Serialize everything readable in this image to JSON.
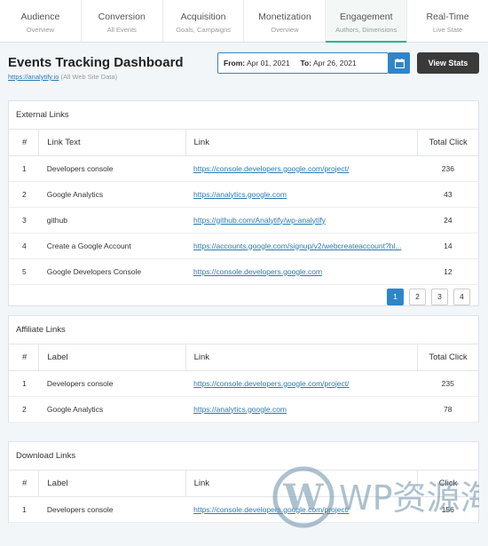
{
  "tabs": [
    {
      "title": "Audience",
      "sub": "Overview"
    },
    {
      "title": "Conversion",
      "sub": "All Events"
    },
    {
      "title": "Acquisition",
      "sub": "Goals, Campaigns"
    },
    {
      "title": "Monetization",
      "sub": "Overview"
    },
    {
      "title": "Engagement",
      "sub": "Authors, Dimensions"
    },
    {
      "title": "Real-Time",
      "sub": "Live State"
    }
  ],
  "header": {
    "title": "Events Tracking Dashboard",
    "site_url": "https://analytify.io",
    "site_note": "(All Web Site Data)"
  },
  "date": {
    "from_label": "From:",
    "from_value": "Apr 01, 2021",
    "to_label": "To:",
    "to_value": "Apr 26, 2021"
  },
  "view_stats": "View Stats",
  "external": {
    "title": "External Links",
    "cols": [
      "#",
      "Link Text",
      "Link",
      "Total Click"
    ],
    "rows": [
      {
        "n": "1",
        "text": "Developers console",
        "link": "https://console.developers.google.com/project/",
        "clicks": "236"
      },
      {
        "n": "2",
        "text": "Google Analytics",
        "link": "https://analytics.google.com",
        "clicks": "43"
      },
      {
        "n": "3",
        "text": "github",
        "link": "https://github.com/Analytify/wp-analytify",
        "clicks": "24"
      },
      {
        "n": "4",
        "text": "Create a Google Account",
        "link": "https://accounts.google.com/signup/v2/webcreateaccount?hl...",
        "clicks": "14"
      },
      {
        "n": "5",
        "text": "Google Developers Console",
        "link": "https://console.developers.google.com",
        "clicks": "12"
      }
    ],
    "pages": [
      "1",
      "2",
      "3",
      "4"
    ]
  },
  "affiliate": {
    "title": "Affiliate Links",
    "cols": [
      "#",
      "Label",
      "Link",
      "Total Click"
    ],
    "rows": [
      {
        "n": "1",
        "text": "Developers console",
        "link": "https://console.developers.google.com/project/",
        "clicks": "235"
      },
      {
        "n": "2",
        "text": "Google Analytics",
        "link": "https://analytics.google.com",
        "clicks": "78"
      }
    ]
  },
  "download": {
    "title": "Download Links",
    "cols": [
      "#",
      "Label",
      "Link",
      "Click"
    ],
    "rows": [
      {
        "n": "1",
        "text": "Developers console",
        "link": "https://console.developers.google.com/project/",
        "clicks": "156"
      }
    ]
  },
  "watermark": "WP资源海",
  "colors": {
    "accent": "#2eb38a",
    "blue": "#2f85c9",
    "dark": "#3a3a3a"
  }
}
